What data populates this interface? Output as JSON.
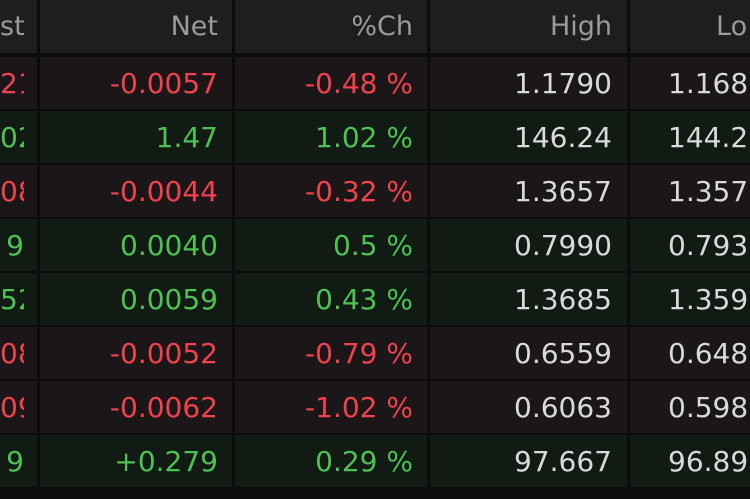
{
  "columns": {
    "last": "st",
    "net": "Net",
    "pct": "%Ch",
    "high": "High",
    "low": "Lo"
  },
  "colors": {
    "negative": "#f0414e",
    "positive": "#4cc254",
    "neutral": "#d9d9d9",
    "header_text": "#9a9a9a"
  },
  "rows": [
    {
      "direction": "down",
      "last": "21",
      "net": "-0.0057",
      "pct": "-0.48 %",
      "high": "1.1790",
      "low": "1.168"
    },
    {
      "direction": "up",
      "last": "02",
      "net": "1.47",
      "pct": "1.02 %",
      "high": "146.24",
      "low": "144.2"
    },
    {
      "direction": "down",
      "last": "08",
      "net": "-0.0044",
      "pct": "-0.32 %",
      "high": "1.3657",
      "low": "1.357"
    },
    {
      "direction": "up",
      "last": "9",
      "net": "0.0040",
      "pct": "0.5 %",
      "high": "0.7990",
      "low": "0.793"
    },
    {
      "direction": "up",
      "last": "52",
      "net": "0.0059",
      "pct": "0.43 %",
      "high": "1.3685",
      "low": "1.359"
    },
    {
      "direction": "down",
      "last": "08",
      "net": "-0.0052",
      "pct": "-0.79 %",
      "high": "0.6559",
      "low": "0.648"
    },
    {
      "direction": "down",
      "last": "09",
      "net": "-0.0062",
      "pct": "-1.02 %",
      "high": "0.6063",
      "low": "0.598"
    },
    {
      "direction": "up",
      "last": "9",
      "net": "+0.279",
      "pct": "0.29 %",
      "high": "97.667",
      "low": "96.89"
    }
  ]
}
